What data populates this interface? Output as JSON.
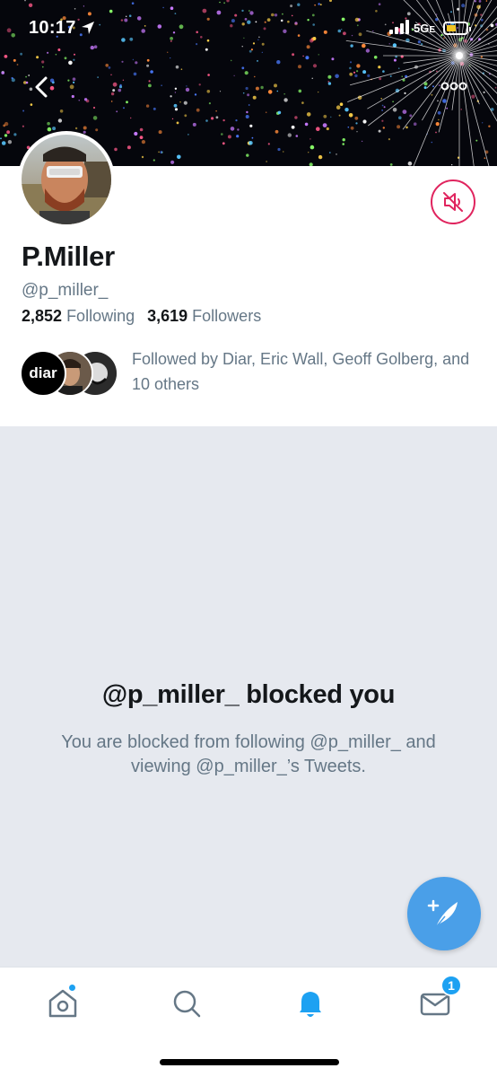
{
  "status_bar": {
    "time": "10:17",
    "network": "5G",
    "network_sub": "E"
  },
  "header": {
    "back_icon": "chevron-left-icon",
    "more_icon": "more-horizontal-icon"
  },
  "profile": {
    "name": "P.Miller",
    "handle": "@p_miller_",
    "following_count": "2,852",
    "following_label": "Following",
    "followers_count": "3,619",
    "followers_label": "Followers",
    "followed_by": "Followed by Diar, Eric Wall, Geoff Golberg, and 10 others",
    "follower_avatar_1_text": "diar",
    "mute_icon": "muted-speaker-icon"
  },
  "blocked": {
    "title": "@p_miller_ blocked you",
    "message": "You are blocked from following @p_miller_ and viewing @p_miller_’s Tweets."
  },
  "tabbar": {
    "items": [
      {
        "name": "home",
        "icon": "home-icon"
      },
      {
        "name": "search",
        "icon": "search-icon"
      },
      {
        "name": "notifications",
        "icon": "bell-icon",
        "active": true
      },
      {
        "name": "messages",
        "icon": "mail-icon"
      }
    ],
    "messages_badge": "1"
  },
  "colors": {
    "accent": "#1da1f2",
    "mute_red": "#e0245e",
    "blocked_bg": "#e6e9ef",
    "fab": "#4a9fe8"
  }
}
